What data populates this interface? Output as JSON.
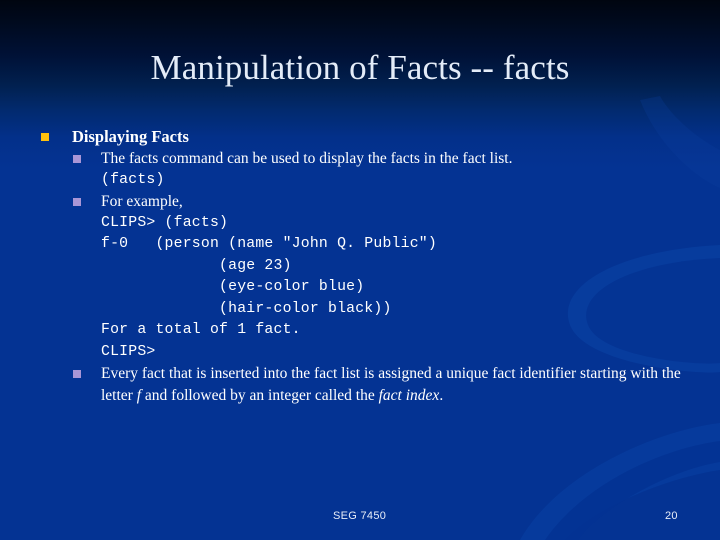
{
  "slide": {
    "title": "Manipulation of Facts -- facts",
    "background_top_color": "#000510",
    "background_bottom_color": "#043393",
    "title_color": "#E4ECF8",
    "bullet_level1_color": "#FFC20E",
    "bullet_level2_color": "#A996D6",
    "body_text_color": "#FFFFFF"
  },
  "body": {
    "heading": "Displaying Facts",
    "b1": "The facts command can be used to display the facts in the fact list.",
    "b1_code": "(facts)",
    "b2": "For example,",
    "code_lines": [
      "CLIPS> (facts)",
      "f-0   (person (name \"John Q. Public\")",
      "             (age 23)",
      "             (eye-color blue)",
      "             (hair-color black))",
      "For a total of 1 fact.",
      "CLIPS>"
    ],
    "b3_part1": "Every fact that is inserted into the fact list is assigned a unique fact identifier starting with the letter ",
    "b3_italic_f": "f",
    "b3_part2": " and followed by an integer called the ",
    "b3_italic_term": "fact index",
    "b3_part3": "."
  },
  "footer": {
    "course": "SEG 7450",
    "page_number": "20"
  }
}
